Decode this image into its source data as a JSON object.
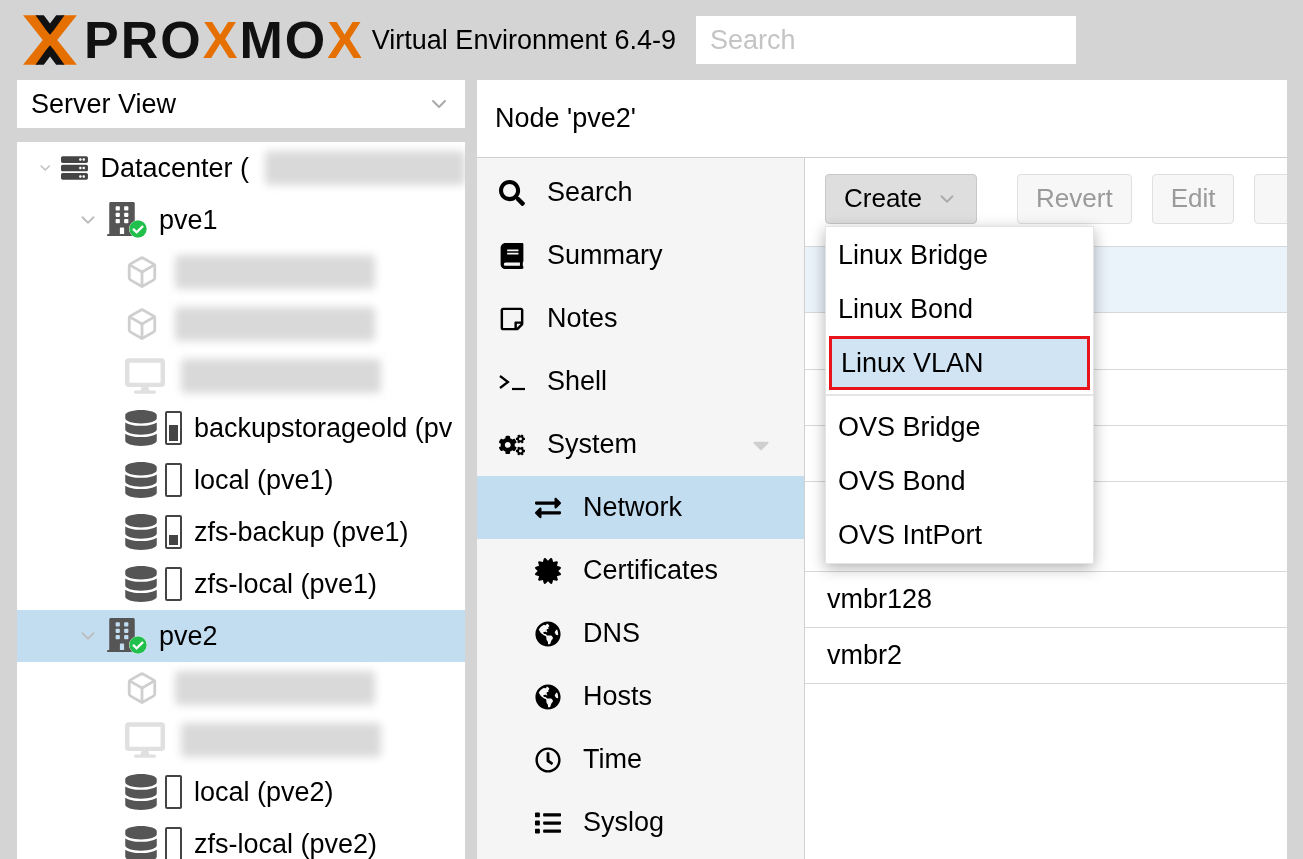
{
  "header": {
    "logo_parts": [
      {
        "text": "PRO",
        "accent": false
      },
      {
        "text": "X",
        "accent": true
      },
      {
        "text": "MO",
        "accent": false
      },
      {
        "text": "X",
        "accent": true
      }
    ],
    "title": "Virtual Environment 6.4-9",
    "search": {
      "placeholder": "Search"
    }
  },
  "view_selector": {
    "value": "Server View"
  },
  "tree": [
    {
      "kind": "datacenter",
      "label": "Datacenter (",
      "blurred": true,
      "expanded": true,
      "selected": false,
      "children": [
        {
          "kind": "node",
          "label": "pve1",
          "expanded": true,
          "selected": false,
          "children": [
            {
              "kind": "container",
              "blurred": true,
              "selected": false
            },
            {
              "kind": "container",
              "blurred": true,
              "selected": false
            },
            {
              "kind": "vm",
              "blurred": true,
              "selected": false
            },
            {
              "kind": "storagehigh",
              "label": "backupstorageold (pv",
              "selected": false
            },
            {
              "kind": "storageempty",
              "label": "local (pve1)",
              "selected": false
            },
            {
              "kind": "storagelow",
              "label": "zfs-backup (pve1)",
              "selected": false
            },
            {
              "kind": "storageempty",
              "label": "zfs-local (pve1)",
              "selected": false
            }
          ]
        },
        {
          "kind": "node",
          "label": "pve2",
          "expanded": true,
          "selected": true,
          "children": [
            {
              "kind": "container",
              "blurred": true,
              "selected": false
            },
            {
              "kind": "vm",
              "blurred": true,
              "selected": false
            },
            {
              "kind": "storageempty",
              "label": "local (pve2)",
              "selected": false
            },
            {
              "kind": "storageempty",
              "label": "zfs-local (pve2)",
              "selected": false
            }
          ]
        }
      ]
    }
  ],
  "panel_title": "Node 'pve2'",
  "nav": [
    {
      "kind": "search",
      "label": "Search",
      "selected": false
    },
    {
      "kind": "book",
      "label": "Summary",
      "selected": false
    },
    {
      "kind": "note",
      "label": "Notes",
      "selected": false
    },
    {
      "kind": "terminal",
      "label": "Shell",
      "selected": false
    },
    {
      "kind": "gears",
      "label": "System",
      "selected": false,
      "expanded": true,
      "children": [
        {
          "kind": "exchange",
          "label": "Network",
          "selected": true
        },
        {
          "kind": "certificate",
          "label": "Certificates",
          "selected": false
        },
        {
          "kind": "globe",
          "label": "DNS",
          "selected": false
        },
        {
          "kind": "globe",
          "label": "Hosts",
          "selected": false
        },
        {
          "kind": "clock",
          "label": "Time",
          "selected": false
        },
        {
          "kind": "list",
          "label": "Syslog",
          "selected": false
        }
      ]
    }
  ],
  "toolbar": {
    "create": {
      "label": "Create",
      "pressed": true
    },
    "buttons": [
      {
        "label": "Revert",
        "disabled": true
      },
      {
        "label": "Edit",
        "disabled": true
      },
      {
        "disabled": true
      }
    ]
  },
  "create_menu": {
    "groups": [
      [
        {
          "label": "Linux Bridge",
          "selected": false,
          "outlined": false
        },
        {
          "label": "Linux Bond",
          "selected": false,
          "outlined": false
        },
        {
          "label": "Linux VLAN",
          "selected": true,
          "outlined": true
        }
      ],
      [
        {
          "label": "OVS Bridge",
          "selected": false,
          "outlined": false
        },
        {
          "label": "OVS Bond",
          "selected": false,
          "outlined": false
        },
        {
          "label": "OVS IntPort",
          "selected": false,
          "outlined": false
        }
      ]
    ]
  },
  "table": {
    "rows": [
      {
        "selected": true
      },
      {
        "selected": false
      },
      {
        "selected": false
      },
      {
        "selected": false
      },
      {
        "selected": false
      },
      {
        "name": "vmbr128",
        "selected": false
      },
      {
        "name": "vmbr2",
        "selected": false
      }
    ]
  }
}
